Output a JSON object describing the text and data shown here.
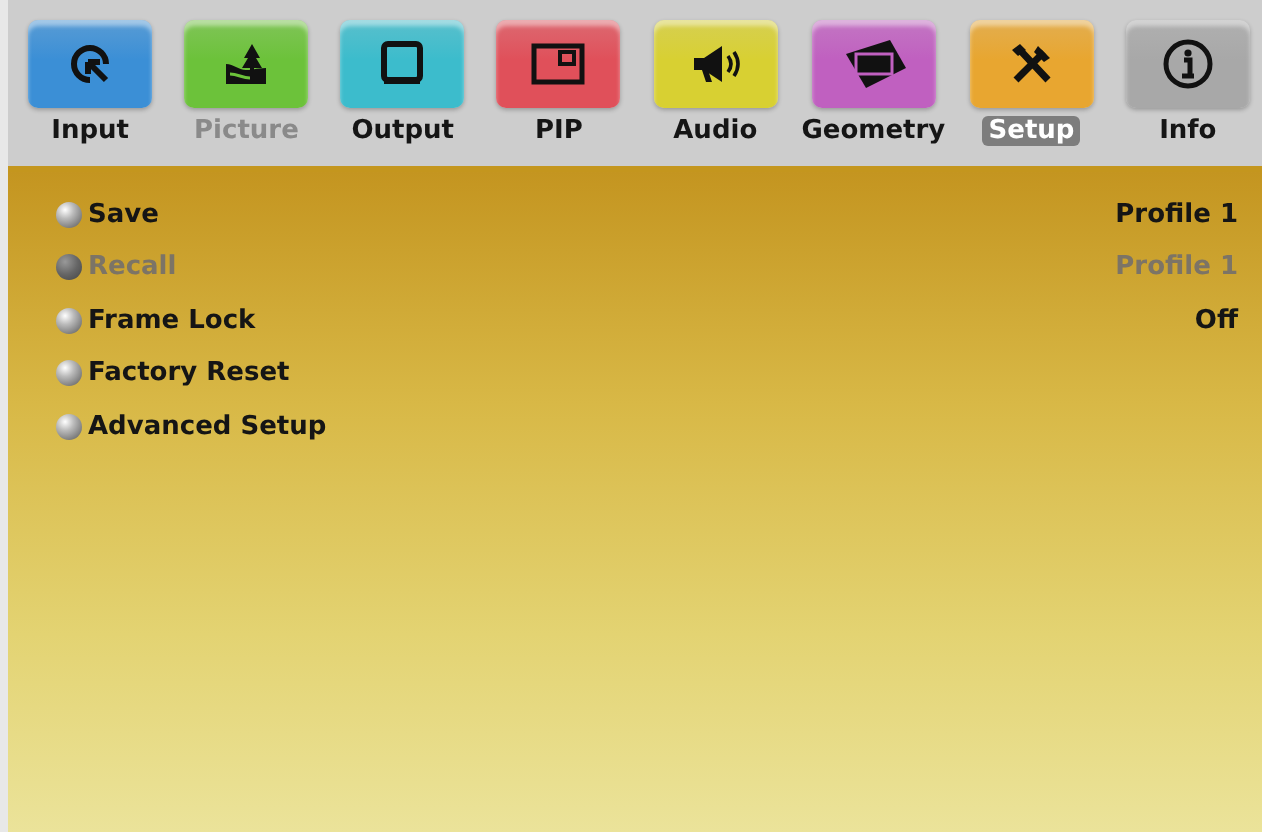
{
  "tabs": [
    {
      "label": "Input",
      "color": "#3b8fd6",
      "selected": false,
      "disabled": false
    },
    {
      "label": "Picture",
      "color": "#6cc23a",
      "selected": false,
      "disabled": true
    },
    {
      "label": "Output",
      "color": "#3cbccc",
      "selected": false,
      "disabled": false
    },
    {
      "label": "PIP",
      "color": "#e0505a",
      "selected": false,
      "disabled": false
    },
    {
      "label": "Audio",
      "color": "#d8d032",
      "selected": false,
      "disabled": false
    },
    {
      "label": "Geometry",
      "color": "#c060c0",
      "selected": false,
      "disabled": false
    },
    {
      "label": "Setup",
      "color": "#e8a630",
      "selected": true,
      "disabled": false
    },
    {
      "label": "Info",
      "color": "#a8a8a8",
      "selected": false,
      "disabled": false
    }
  ],
  "menu": [
    {
      "label": "Save",
      "value": "Profile 1",
      "disabled": false
    },
    {
      "label": "Recall",
      "value": "Profile 1",
      "disabled": true
    },
    {
      "label": "Frame Lock",
      "value": "Off",
      "disabled": false
    },
    {
      "label": "Factory Reset",
      "disabled": false
    },
    {
      "label": "Advanced Setup",
      "disabled": false
    }
  ]
}
